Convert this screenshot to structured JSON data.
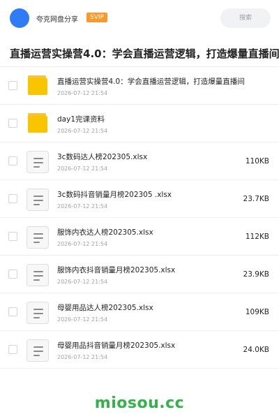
{
  "header": {
    "share_name": "夸克网盘分享",
    "badge": "SVIP",
    "search_placeholder": "搜索"
  },
  "title": "直播运营实操营4.0：学会直播运营逻辑，打造爆量直播间",
  "files": [
    {
      "type": "folder",
      "name": "直播运营实操营4.0：学会直播运营逻辑，打造爆量直播间",
      "date": "2026-07-12 21:54",
      "size": ""
    },
    {
      "type": "folder",
      "name": "day1完课资料",
      "date": "2026-07-12 21:54",
      "size": ""
    },
    {
      "type": "doc",
      "name": "3c数码达人榜202305.xlsx",
      "date": "2026-07-12 21:54",
      "size": "110KB"
    },
    {
      "type": "doc",
      "name": "3c数码抖音销量月榜202305 .xlsx",
      "date": "2026-07-12 21:54",
      "size": "23.7KB"
    },
    {
      "type": "doc",
      "name": "服饰内衣达人榜202305.xlsx",
      "date": "2026-07-12 21:54",
      "size": "112KB"
    },
    {
      "type": "doc",
      "name": "服饰内衣抖音销量月榜202305.xlsx",
      "date": "2026-07-12 21:54",
      "size": "23.9KB"
    },
    {
      "type": "doc",
      "name": "母婴用品达人榜202305.xlsx",
      "date": "2026-07-12 21:54",
      "size": "109KB"
    },
    {
      "type": "doc",
      "name": "母婴用品抖音销量月榜202305.xlsx",
      "date": "2026-07-12 21:54",
      "size": "24.0KB"
    }
  ],
  "footer": {
    "brand": "miosou.cc"
  },
  "colors": {
    "accent": "#2f7cf6",
    "svip": "#f79a2a",
    "folder": "#f9c400",
    "brand": "#34b24a"
  }
}
